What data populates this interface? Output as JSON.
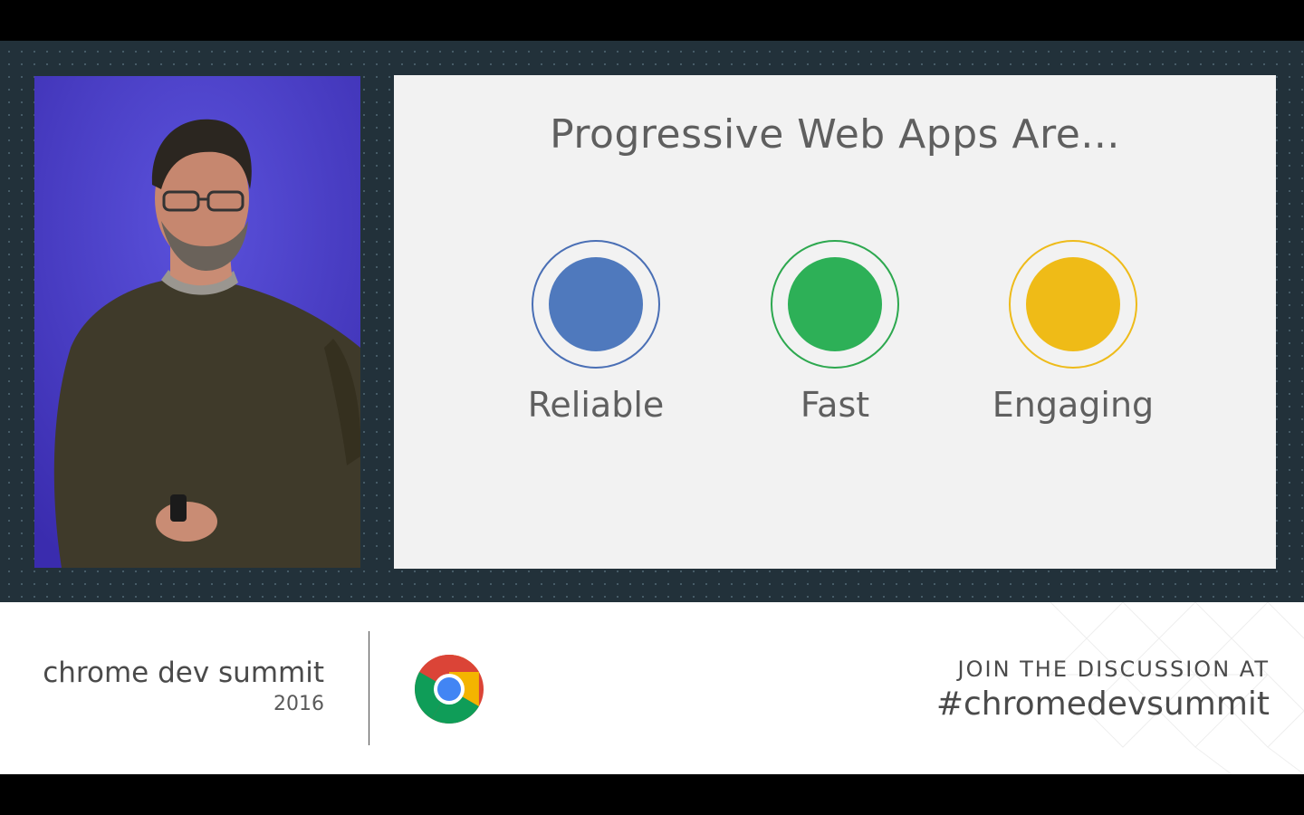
{
  "slide": {
    "title": "Progressive Web Apps Are...",
    "pillars": [
      {
        "label": "Reliable",
        "color": "#4f79bd",
        "ring_color": "#4a6fb5",
        "icon": "reliable-circle-icon"
      },
      {
        "label": "Fast",
        "color": "#2db057",
        "ring_color": "#2da84f",
        "icon": "fast-circle-icon"
      },
      {
        "label": "Engaging",
        "color": "#efbb17",
        "ring_color": "#eebb1a",
        "icon": "engaging-circle-icon"
      }
    ]
  },
  "banner": {
    "brand_name": "chrome dev summit",
    "brand_year": "2016",
    "logo_icon": "chrome-logo-icon",
    "cta_line": "JOIN THE DISCUSSION AT",
    "hashtag": "#chromedevsummit"
  },
  "colors": {
    "stage_background": "#22313a",
    "slide_background": "#f2f2f2",
    "slide_text": "#5f5f5f",
    "banner_text": "#4a4a4a"
  }
}
